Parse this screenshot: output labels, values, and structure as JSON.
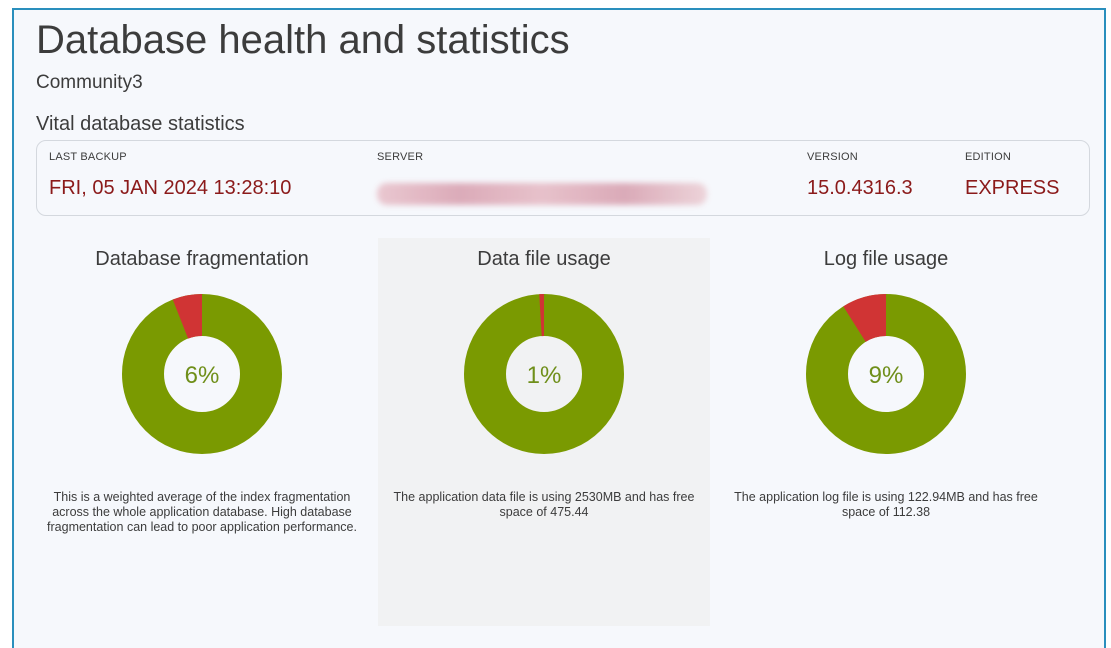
{
  "header": {
    "title": "Database health and statistics",
    "subtitle": "Community3"
  },
  "vitals": {
    "section_title": "Vital database statistics",
    "last_backup": {
      "label": "LAST BACKUP",
      "value": "FRI, 05 JAN 2024 13:28:10"
    },
    "server": {
      "label": "SERVER"
    },
    "version": {
      "label": "VERSION",
      "value": "15.0.4316.3"
    },
    "edition": {
      "label": "EDITION",
      "value": "EXPRESS"
    }
  },
  "colors": {
    "good": "#7a9a01",
    "bad": "#d03434",
    "value_text": "#8b1a1a",
    "accent_border": "#2a8fbd"
  },
  "charts": {
    "fragmentation": {
      "title": "Database fragmentation",
      "percent_label": "6%",
      "percent": 6,
      "description": "This is a weighted average of the index fragmentation across the whole application database. High database fragmentation can lead to poor application performance."
    },
    "data_file": {
      "title": "Data file usage",
      "percent_label": "1%",
      "percent": 1,
      "description": "The application data file is using 2530MB and has free space of 475.44"
    },
    "log_file": {
      "title": "Log file usage",
      "percent_label": "9%",
      "percent": 9,
      "description": "The application log file is using 122.94MB and has free space of 112.38"
    }
  }
}
